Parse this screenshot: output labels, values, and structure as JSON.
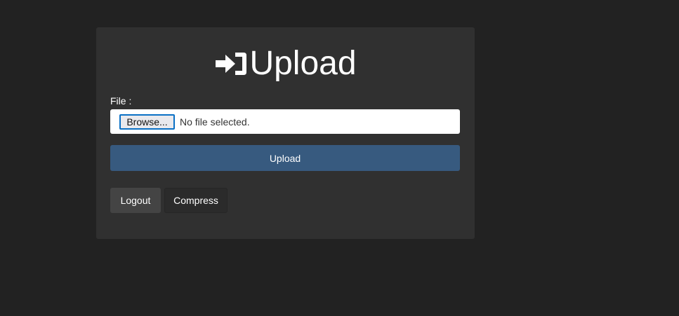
{
  "title": {
    "icon": "sign-in-icon",
    "text": "Upload"
  },
  "form": {
    "file_label": "File :",
    "browse_label": "Browse...",
    "file_status": "No file selected.",
    "upload_label": "Upload"
  },
  "actions": {
    "logout_label": "Logout",
    "compress_label": "Compress"
  },
  "colors": {
    "page_background": "#222222",
    "card_background": "#303030",
    "primary_button": "#375a7f",
    "secondary_button": "#444444"
  }
}
